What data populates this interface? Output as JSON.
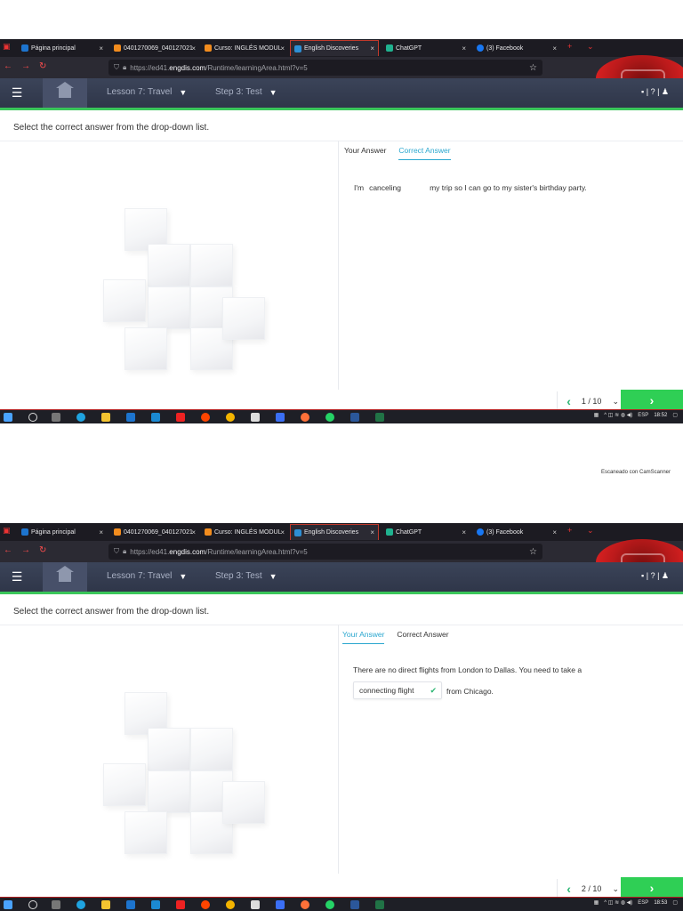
{
  "browser": {
    "tabs": [
      {
        "label": "Página principal",
        "color": "#1d74ce"
      },
      {
        "label": "0401270069_040127021",
        "color": "#f28c1e"
      },
      {
        "label": "Curso: INGLÉS MODUL",
        "color": "#f28c1e"
      },
      {
        "label": "English Discoveries",
        "color": "#2d8fd5"
      },
      {
        "label": "ChatGPT",
        "color": "#20b28f"
      },
      {
        "label": "(3) Facebook",
        "color": "#1877f2"
      }
    ],
    "url_prefix": "https://ed41.",
    "url_host": "engdis.com",
    "url_suffix": "/Runtime/learningArea.html?v=5"
  },
  "header": {
    "menu_icon": "☰",
    "lesson_label": "Lesson 7: Travel",
    "step_label": "Step 3: Test",
    "right_icons": "▪ | ? | ♟"
  },
  "instruction": "Select the correct answer from the drop-down list.",
  "answer_tabs": {
    "your_answer": "Your Answer",
    "correct_answer": "Correct Answer"
  },
  "question1": {
    "before": "I'm",
    "answer": "canceling",
    "after": "my trip so I can go to my sister's birthday party.",
    "pager": "1 / 10"
  },
  "question2": {
    "text": "There are no direct flights from London to Dallas. You need to take a",
    "answer": "connecting flight",
    "after": "from Chicago.",
    "pager": "2 / 10"
  },
  "taskbar": {
    "lang": "ESP",
    "time1": "18:52",
    "time2": "18:53"
  },
  "watermark": "Escaneado con CamScanner",
  "colors": {
    "accent_green": "#2fcf55",
    "link_blue": "#2aa7cf",
    "header_bg": "#353d51"
  }
}
